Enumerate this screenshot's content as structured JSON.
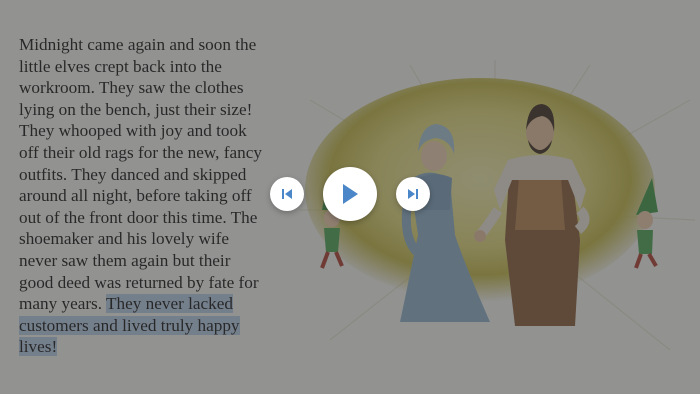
{
  "story": {
    "text_before": "Midnight came again and soon the little elves crept back into the workroom. They saw the clothes lying on the bench, just their size! They whooped with joy and took off their old rags for the new, fancy outfits. They danced and skipped around all night, before taking off out of the front door this time. The shoemaker and his lovely wife never saw them again but their good deed was returned by fate for many years. ",
    "text_highlighted": "They never lacked customers and lived truly happy lives!"
  },
  "colors": {
    "highlight": "#b9d0ee",
    "control_icon": "#4a86c8",
    "overlay": "rgba(60,60,60,0.55)"
  },
  "controls": {
    "previous_icon": "skip-previous-icon",
    "play_icon": "play-icon",
    "next_icon": "skip-next-icon"
  }
}
